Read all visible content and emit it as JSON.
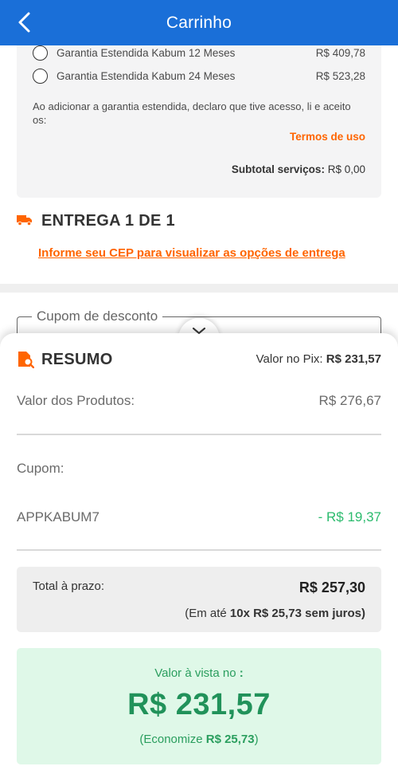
{
  "header": {
    "title": "Carrinho"
  },
  "warranty": {
    "options": [
      {
        "label": "Garantia Estendida Kabum 12 Meses",
        "price": "R$ 409,78"
      },
      {
        "label": "Garantia Estendida Kabum 24 Meses",
        "price": "R$ 523,28"
      }
    ],
    "terms_text": "Ao adicionar a garantia estendida, declaro que tive acesso, li e aceito os:",
    "terms_link": "Termos de uso",
    "subtotal_label": "Subtotal serviços:",
    "subtotal_value": "R$ 0,00"
  },
  "delivery": {
    "title": "ENTREGA 1 DE 1",
    "cep_link": "Informe seu CEP para visualizar as opções de entrega"
  },
  "coupon": {
    "placeholder": "Cupom de desconto"
  },
  "summary": {
    "title": "RESUMO",
    "pix_label": "Valor no Pix:",
    "pix_value": "R$ 231,57",
    "products_label": "Valor dos Produtos:",
    "products_value": "R$ 276,67",
    "coupon_label": "Cupom:",
    "coupon_code": "APPKABUM7",
    "coupon_discount": "- R$ 19,37",
    "total_label": "Total à prazo:",
    "total_value": "R$ 257,30",
    "installment_prefix": "(Em até",
    "installment_value": "10x R$ 25,73 sem juros)",
    "cash_label": "Valor à vista no",
    "cash_label_suffix": ":",
    "cash_value": "R$ 231,57",
    "savings_prefix": "(Economize",
    "savings_value": "R$ 25,73",
    "savings_suffix": ")"
  },
  "colors": {
    "header": "#1a6fd8",
    "accent": "#ff6500",
    "green": "#21925a",
    "discount": "#2bbb6d"
  }
}
